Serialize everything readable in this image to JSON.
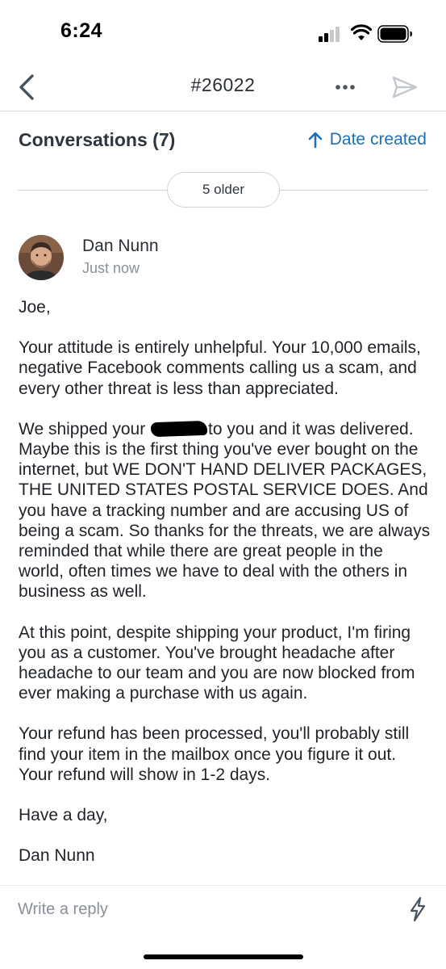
{
  "status_bar": {
    "time": "6:24",
    "signal_icon": "cellular-signal-icon",
    "wifi_icon": "wifi-icon",
    "battery_icon": "battery-icon"
  },
  "nav": {
    "title": "#26022",
    "back_icon": "chevron-left-icon",
    "more_icon": "ellipsis-icon",
    "send_icon": "paper-plane-icon"
  },
  "conversations": {
    "title": "Conversations (7)",
    "sort_label": "Date created",
    "sort_icon": "arrow-up-icon",
    "older_label": "5 older"
  },
  "message": {
    "sender": "Dan Nunn",
    "time": "Just now",
    "greeting": "Joe,",
    "paragraph1": "Your attitude is entirely unhelpful. Your 10,000 emails, negative Facebook comments calling us a scam, and every other threat is less than appreciated.",
    "paragraph2_before": "We shipped your ",
    "paragraph2_after": "to you and it was delivered. Maybe this is the first thing you've ever bought on the internet, but WE DON'T HAND DELIVER PACKAGES, THE UNITED STATES POSTAL SERVICE DOES. And you have a tracking number and are accusing US of being a scam. So thanks for the threats, we are always reminded that while there are great people in the world, often times we have to deal with the others in business as well.",
    "paragraph3": "At this point, despite shipping your product, I'm firing you as a customer. You've brought headache after headache to our team and you are now blocked from ever making a purchase with us again.",
    "paragraph4": "Your refund has been processed, you'll probably still find your item in the mailbox once you figure it out. Your refund will show in 1-2 days.",
    "closing": "Have a day,",
    "signature": "Dan Nunn"
  },
  "reply": {
    "placeholder": "Write a reply",
    "value": "",
    "quick_action_icon": "lightning-icon"
  },
  "colors": {
    "accent": "#1f6fb5",
    "text": "#1f2328",
    "muted": "#8a9099",
    "divider": "#cfd3d8"
  }
}
